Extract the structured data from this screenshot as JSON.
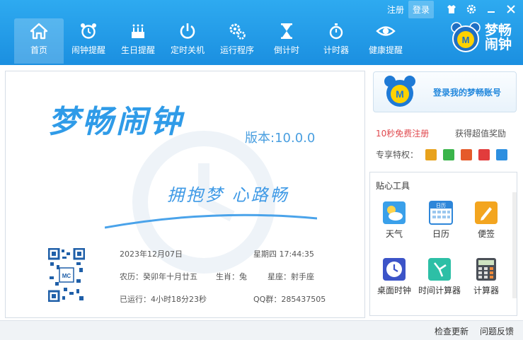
{
  "header": {
    "register": "注册",
    "login": "登录",
    "brand_line1": "梦畅",
    "brand_line2": "闹钟"
  },
  "nav": [
    {
      "label": "首页",
      "icon": "home-icon"
    },
    {
      "label": "闹钟提醒",
      "icon": "alarm-clock-icon"
    },
    {
      "label": "生日提醒",
      "icon": "birthday-cake-icon"
    },
    {
      "label": "定时关机",
      "icon": "power-icon"
    },
    {
      "label": "运行程序",
      "icon": "gears-icon"
    },
    {
      "label": "倒计时",
      "icon": "hourglass-icon"
    },
    {
      "label": "计时器",
      "icon": "stopwatch-icon"
    },
    {
      "label": "健康提醒",
      "icon": "eye-icon"
    }
  ],
  "main": {
    "title": "梦畅闹钟",
    "version": "版本:10.0.0",
    "slogan": "拥抱梦 心路畅",
    "date": "2023年12月07日",
    "weekday_time": "星期四 17:44:35",
    "lunar": "农历：癸卯年十月廿五",
    "zodiac": "生肖：兔",
    "constellation": "星座：射手座",
    "uptime": "已运行：4小时18分23秒",
    "qq_group": "QQ群：285437505"
  },
  "account": {
    "label": "登录我的梦畅账号",
    "free_register": "10秒免费注册",
    "reward": "获得超值奖励",
    "privileges_label": "专享特权："
  },
  "tools": {
    "title": "贴心工具",
    "items": [
      {
        "label": "天气",
        "icon": "weather-icon"
      },
      {
        "label": "日历",
        "icon": "calendar-icon"
      },
      {
        "label": "便签",
        "icon": "note-icon"
      },
      {
        "label": "桌面时钟",
        "icon": "desktop-clock-icon"
      },
      {
        "label": "时间计算器",
        "icon": "time-calculator-icon"
      },
      {
        "label": "计算器",
        "icon": "calculator-icon"
      }
    ],
    "calendar_header": "日历"
  },
  "footer": {
    "check_update": "检查更新",
    "feedback": "问题反馈"
  },
  "colors": {
    "header": "#1b8fe0",
    "accent": "#2f9be8",
    "red": "#e0484d"
  }
}
